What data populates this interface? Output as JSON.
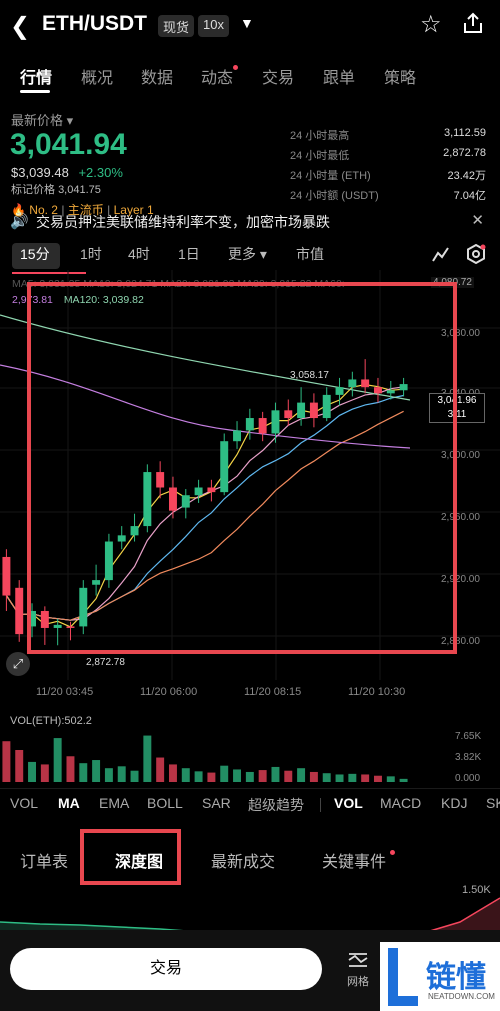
{
  "header": {
    "pair": "ETH/USDT",
    "spot_tag": "现货",
    "leverage_tag": "10x"
  },
  "tabs": [
    "行情",
    "概况",
    "数据",
    "动态",
    "交易",
    "跟单",
    "策略"
  ],
  "price": {
    "label": "最新价格",
    "last": "3,041.94",
    "usd": "$3,039.48",
    "change": "+2.30%",
    "mark_label": "标记价格",
    "mark": "3,041.75",
    "rank": "No. 2",
    "tag1": "主流币",
    "tag2": "Layer 1"
  },
  "stats": [
    {
      "label": "24 小时最高",
      "value": "3,112.59"
    },
    {
      "label": "24 小时最低",
      "value": "2,872.78"
    },
    {
      "label": "24 小时量 (ETH)",
      "value": "23.42万"
    },
    {
      "label": "24 小时额 (USDT)",
      "value": "7.04亿"
    }
  ],
  "news": "交易员押注美联储维持利率不变，加密市场暴跌",
  "intervals": [
    "15分",
    "1时",
    "4时",
    "1日",
    "更多",
    "市值"
  ],
  "ma_legend": {
    "line1": "MA5: 3,031.35   MA10: 3,024.71   MA20: 3,021.93   MA30: 3,015.22   MA60:",
    "ma_prefix": "2,9",
    "ma_value": "73.81",
    "ma120": "MA120: 3,039.82"
  },
  "chart_labels": {
    "high": "3,058.17",
    "low": "2,872.78",
    "top_right": "4,080.72",
    "current": "3,041.96",
    "countdown": "3:11",
    "y_ticks": [
      "3,080.00",
      "3,040.00",
      "3,000.00",
      "2,960.00",
      "2,920.00",
      "2,880.00"
    ],
    "x_ticks": [
      "11/20 03:45",
      "11/20 06:00",
      "11/20 08:15",
      "11/20 10:30"
    ]
  },
  "volume": {
    "label": "VOL(ETH):502.2",
    "ticks": [
      "7.65K",
      "3.82K",
      "0.000"
    ]
  },
  "indicators": [
    "VOL",
    "MA",
    "EMA",
    "BOLL",
    "SAR",
    "超级趋势",
    "VOL",
    "MACD",
    "KDJ",
    "SK"
  ],
  "sub_tabs": [
    "订单表",
    "深度图",
    "最新成交",
    "关键事件"
  ],
  "depth_value": "1.50K",
  "bottom": {
    "trade": "交易",
    "grid": "网格",
    "logo": "链懂",
    "logo_sub": "NEATDOWN.COM"
  },
  "colors": {
    "up": "#2ebd85",
    "down": "#f6465d",
    "highlight": "#e8474f"
  },
  "chart_data": {
    "type": "candlestick",
    "x_ticks": [
      "11/20 03:45",
      "11/20 06:00",
      "11/20 08:15",
      "11/20 10:30"
    ],
    "ylim": [
      2860,
      3090
    ],
    "candles": [
      {
        "o": 2930,
        "c": 2905,
        "h": 2935,
        "l": 2895
      },
      {
        "o": 2910,
        "c": 2880,
        "h": 2915,
        "l": 2875
      },
      {
        "o": 2885,
        "c": 2895,
        "h": 2900,
        "l": 2878
      },
      {
        "o": 2895,
        "c": 2884,
        "h": 2898,
        "l": 2873
      },
      {
        "o": 2884,
        "c": 2886,
        "h": 2890,
        "l": 2872.78
      },
      {
        "o": 2885,
        "c": 2884,
        "h": 2888,
        "l": 2876
      },
      {
        "o": 2885,
        "c": 2910,
        "h": 2915,
        "l": 2880
      },
      {
        "o": 2912,
        "c": 2915,
        "h": 2925,
        "l": 2905
      },
      {
        "o": 2915,
        "c": 2940,
        "h": 2945,
        "l": 2910
      },
      {
        "o": 2940,
        "c": 2944,
        "h": 2950,
        "l": 2935
      },
      {
        "o": 2944,
        "c": 2950,
        "h": 2958,
        "l": 2940
      },
      {
        "o": 2950,
        "c": 2985,
        "h": 2990,
        "l": 2946
      },
      {
        "o": 2985,
        "c": 2975,
        "h": 2992,
        "l": 2968
      },
      {
        "o": 2975,
        "c": 2960,
        "h": 2982,
        "l": 2955
      },
      {
        "o": 2962,
        "c": 2970,
        "h": 2974,
        "l": 2955
      },
      {
        "o": 2970,
        "c": 2975,
        "h": 2980,
        "l": 2965
      },
      {
        "o": 2975,
        "c": 2972,
        "h": 2980,
        "l": 2966
      },
      {
        "o": 2972,
        "c": 3005,
        "h": 3010,
        "l": 2970
      },
      {
        "o": 3005,
        "c": 3012,
        "h": 3018,
        "l": 3000
      },
      {
        "o": 3012,
        "c": 3020,
        "h": 3026,
        "l": 3006
      },
      {
        "o": 3020,
        "c": 3010,
        "h": 3024,
        "l": 3005
      },
      {
        "o": 3010,
        "c": 3025,
        "h": 3030,
        "l": 3004
      },
      {
        "o": 3025,
        "c": 3020,
        "h": 3032,
        "l": 3015
      },
      {
        "o": 3020,
        "c": 3030,
        "h": 3040,
        "l": 3015
      },
      {
        "o": 3030,
        "c": 3020,
        "h": 3036,
        "l": 3014
      },
      {
        "o": 3020,
        "c": 3035,
        "h": 3040,
        "l": 3018
      },
      {
        "o": 3035,
        "c": 3040,
        "h": 3046,
        "l": 3028
      },
      {
        "o": 3040,
        "c": 3045,
        "h": 3050,
        "l": 3034
      },
      {
        "o": 3045,
        "c": 3040,
        "h": 3058.17,
        "l": 3036
      },
      {
        "o": 3040,
        "c": 3036,
        "h": 3046,
        "l": 3030
      },
      {
        "o": 3036,
        "c": 3038,
        "h": 3044,
        "l": 3032
      },
      {
        "o": 3038,
        "c": 3042,
        "h": 3046,
        "l": 3034
      }
    ],
    "volume": [
      6.5,
      5.1,
      3.2,
      2.8,
      7.0,
      4.1,
      3.0,
      3.5,
      2.2,
      2.5,
      1.8,
      7.4,
      3.9,
      2.8,
      2.2,
      1.7,
      1.5,
      2.6,
      2.0,
      1.6,
      1.9,
      2.4,
      1.8,
      2.2,
      1.6,
      1.4,
      1.2,
      1.3,
      1.2,
      1.0,
      0.9,
      0.5
    ]
  }
}
